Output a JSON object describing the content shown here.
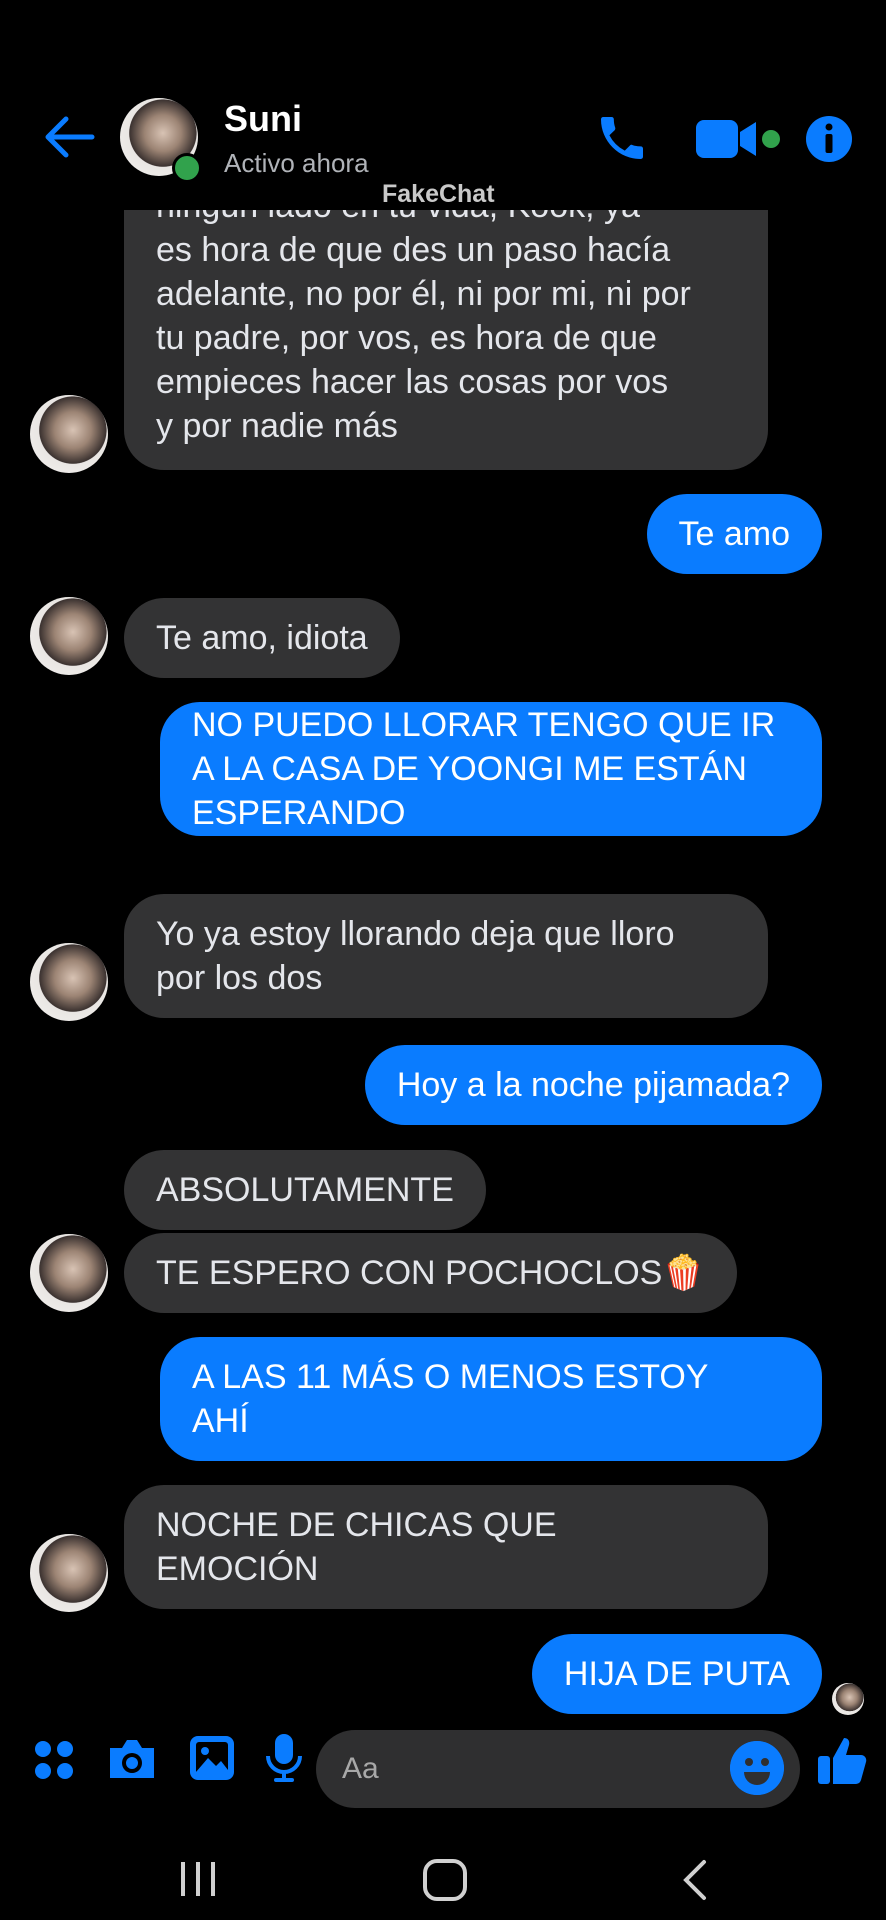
{
  "header": {
    "name": "Suni",
    "status": "Activo ahora",
    "watermark": "FakeChat"
  },
  "messages": [
    {
      "side": "in",
      "lines": [
        "ningún lado en tu vida, Kook, ya",
        "es hora de que des un paso hacía",
        "adelante, no por él, ni por mi, ni por",
        "tu padre, por vos, es hora de que",
        "empieces hacer las cosas por vos",
        "y por nadie más"
      ]
    },
    {
      "side": "out",
      "lines": [
        "Te amo"
      ]
    },
    {
      "side": "in",
      "lines": [
        "Te amo, idiota"
      ]
    },
    {
      "side": "out",
      "lines": [
        "NO PUEDO LLORAR TENGO QUE IR",
        "A LA CASA DE YOONGI ME ESTÁN",
        "ESPERANDO"
      ]
    },
    {
      "side": "in",
      "lines": [
        "Yo ya estoy llorando deja que lloro",
        "por los dos"
      ]
    },
    {
      "side": "out",
      "lines": [
        "Hoy a la noche pijamada?"
      ]
    },
    {
      "side": "in",
      "lines": [
        "ABSOLUTAMENTE"
      ]
    },
    {
      "side": "in",
      "lines": [
        "TE ESPERO CON POCHOCLOS🍿"
      ]
    },
    {
      "side": "out",
      "lines": [
        "A LAS 11 MÁS O MENOS ESTOY",
        "AHÍ"
      ]
    },
    {
      "side": "in",
      "lines": [
        "NOCHE DE  CHICAS QUE",
        "EMOCIÓN"
      ]
    },
    {
      "side": "out",
      "lines": [
        "HIJA DE PUTA"
      ]
    }
  ],
  "composer": {
    "placeholder": "Aa",
    "icons": [
      "apps-icon",
      "camera-icon",
      "gallery-icon",
      "microphone-icon",
      "emoji-icon",
      "like-icon"
    ]
  },
  "navbar": {
    "icons": [
      "recent-apps-icon",
      "home-icon",
      "back-nav-icon"
    ]
  },
  "colors": {
    "accent": "#0a7cff",
    "incoming_bubble": "#333334",
    "online": "#31a24c"
  }
}
